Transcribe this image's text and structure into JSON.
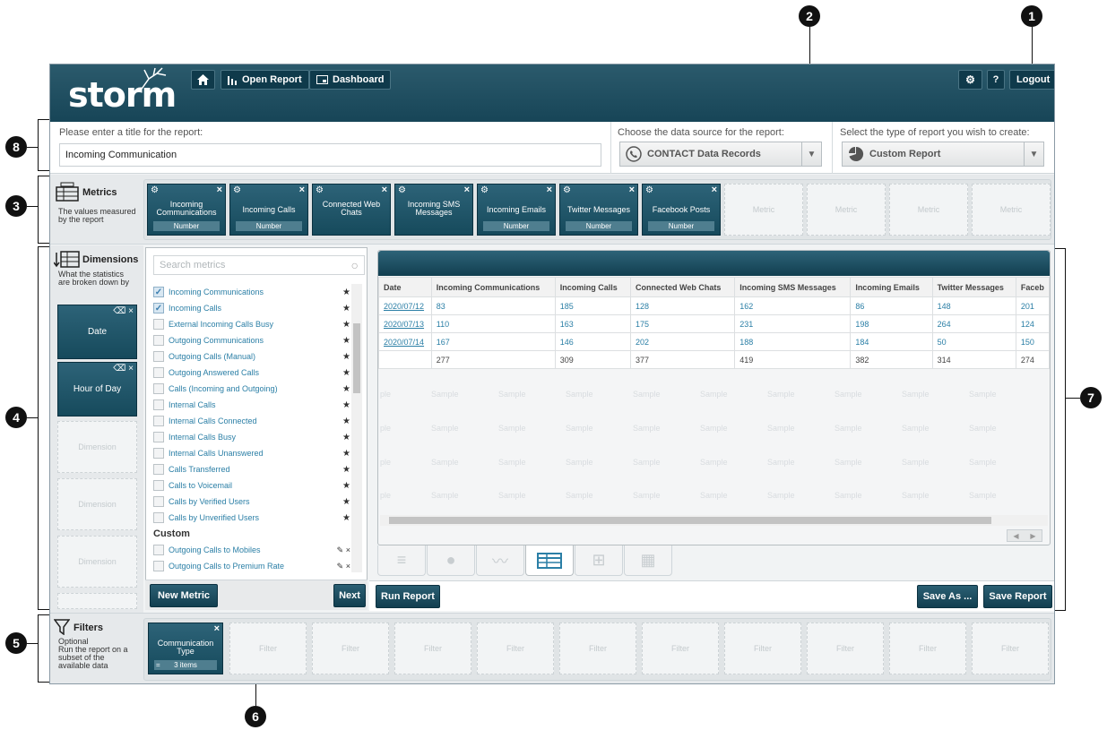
{
  "header": {
    "logo": "storm",
    "nav": [
      {
        "label": "Open Report",
        "icon": "bar-chart-icon"
      },
      {
        "label": "Dashboard",
        "icon": "dashboard-icon"
      }
    ],
    "help_label": "?",
    "logout_label": "Logout"
  },
  "title_section": {
    "label": "Please enter a title for the report:",
    "value": "Incoming Communication"
  },
  "datasource": {
    "label": "Choose the data source for the report:",
    "value": "CONTACT Data Records"
  },
  "report_type": {
    "label": "Select the type of report you wish to create:",
    "value": "Custom Report"
  },
  "metrics_section": {
    "title": "Metrics",
    "desc1": "The values measured",
    "desc2": "by the report",
    "cards": [
      {
        "name1": "Incoming",
        "name2": "Communications",
        "type": "Number"
      },
      {
        "name1": "Incoming Calls",
        "name2": "",
        "type": "Number"
      },
      {
        "name1": "Connected Web",
        "name2": "Chats",
        "type": ""
      },
      {
        "name1": "Incoming SMS",
        "name2": "Messages",
        "type": ""
      },
      {
        "name1": "Incoming Emails",
        "name2": "",
        "type": "Number"
      },
      {
        "name1": "Twitter Messages",
        "name2": "",
        "type": "Number"
      },
      {
        "name1": "Facebook Posts",
        "name2": "",
        "type": "Number"
      }
    ],
    "slot_label": "Metric"
  },
  "dimensions_section": {
    "title": "Dimensions",
    "desc1": "What the statistics",
    "desc2": "are broken down by",
    "cards": [
      "Date",
      "Hour of Day"
    ],
    "slot_label": "Dimension"
  },
  "metric_picker": {
    "search_placeholder": "Search metrics",
    "items": [
      {
        "label": "Incoming Communications",
        "checked": true
      },
      {
        "label": "Incoming Calls",
        "checked": true
      },
      {
        "label": "External Incoming Calls Busy",
        "checked": false
      },
      {
        "label": "Outgoing Communications",
        "checked": false
      },
      {
        "label": "Outgoing Calls (Manual)",
        "checked": false
      },
      {
        "label": "Outgoing Answered Calls",
        "checked": false
      },
      {
        "label": "Calls (Incoming and Outgoing)",
        "checked": false
      },
      {
        "label": "Internal Calls",
        "checked": false
      },
      {
        "label": "Internal Calls Connected",
        "checked": false
      },
      {
        "label": "Internal Calls Busy",
        "checked": false
      },
      {
        "label": "Internal Calls Unanswered",
        "checked": false
      },
      {
        "label": "Calls Transferred",
        "checked": false
      },
      {
        "label": "Calls to Voicemail",
        "checked": false
      },
      {
        "label": "Calls by Verified Users",
        "checked": false
      },
      {
        "label": "Calls by Unverified Users",
        "checked": false
      }
    ],
    "custom_header": "Custom",
    "custom_items": [
      "Outgoing Calls to Mobiles",
      "Outgoing Calls to Premium Rate"
    ],
    "new_metric_label": "New Metric",
    "next_label": "Next"
  },
  "table": {
    "headers": [
      "Date",
      "Incoming Communications",
      "Incoming Calls",
      "Connected Web Chats",
      "Incoming SMS Messages",
      "Incoming Emails",
      "Twitter Messages",
      "Faceb"
    ],
    "rows": [
      [
        "2020/07/12",
        "83",
        "185",
        "128",
        "162",
        "86",
        "148",
        "201"
      ],
      [
        "2020/07/13",
        "110",
        "163",
        "175",
        "231",
        "198",
        "264",
        "124"
      ],
      [
        "2020/07/14",
        "167",
        "146",
        "202",
        "188",
        "184",
        "50",
        "150"
      ],
      [
        "",
        "277",
        "309",
        "377",
        "419",
        "382",
        "314",
        "274"
      ]
    ],
    "sample_label": "Sample",
    "sample_label_cut": "ple"
  },
  "actions": {
    "run_label": "Run Report",
    "save_as_label": "Save As ...",
    "save_label": "Save Report"
  },
  "filters_section": {
    "title": "Filters",
    "desc1": "Optional",
    "desc2": "Run the report on a",
    "desc3": "subset of the",
    "desc4": "available data",
    "card_name1": "Communication",
    "card_name2": "Type",
    "card_count": "3 items",
    "slot_label": "Filter"
  },
  "callouts": [
    "1",
    "2",
    "3",
    "4",
    "5",
    "6",
    "7",
    "8"
  ]
}
